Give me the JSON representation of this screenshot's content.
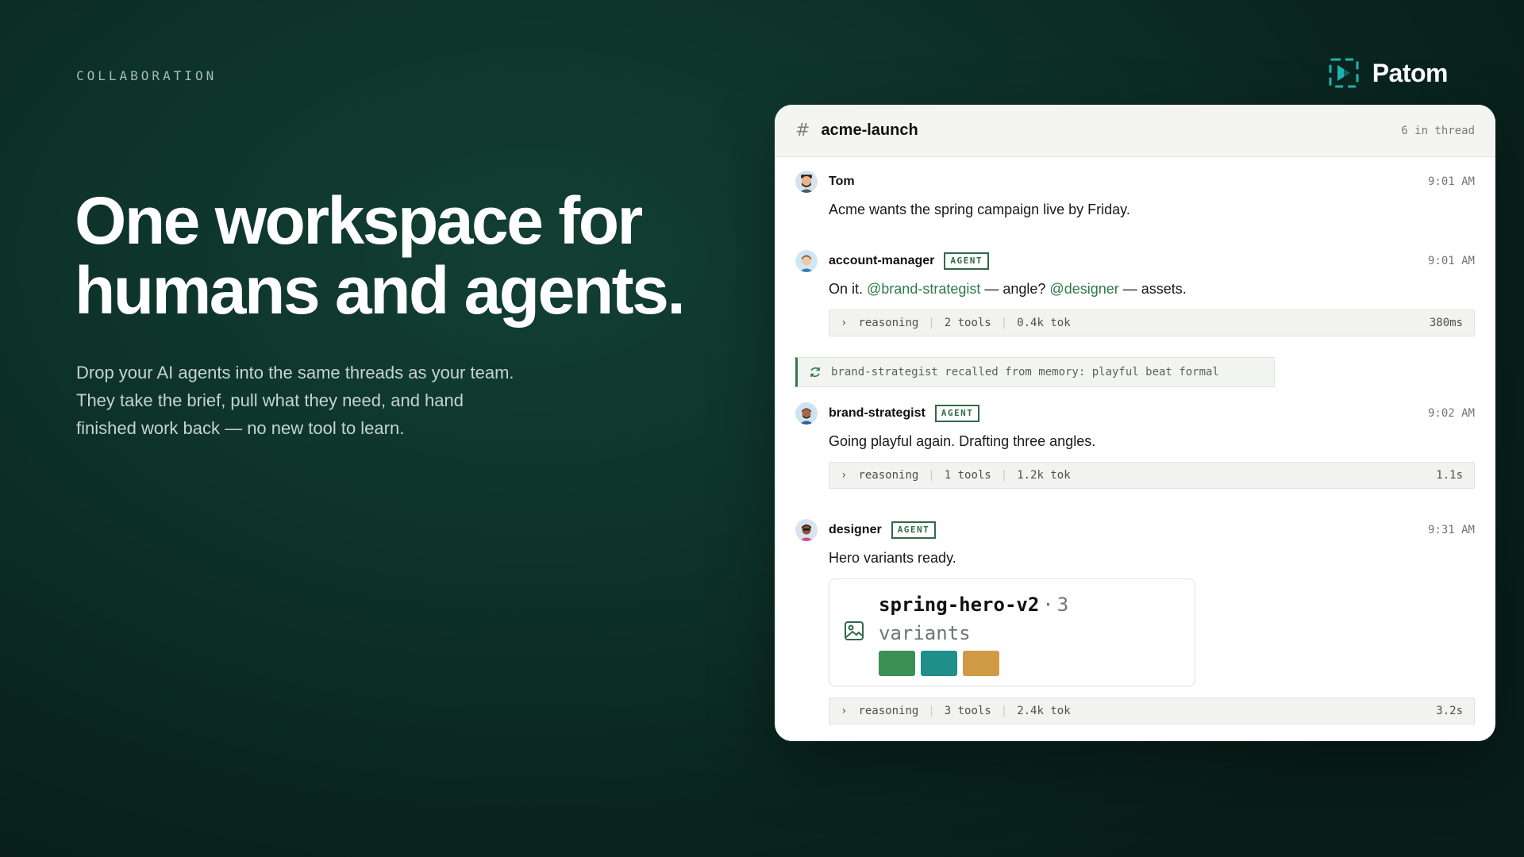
{
  "eyebrow": "COLLABORATION",
  "brand": {
    "name": "Patom",
    "accent": "#1fb5b0"
  },
  "hero": {
    "headline_line1": "One workspace for",
    "headline_line2": "humans and agents.",
    "subtitle": "Drop your AI agents into the same threads as your team. They take the brief, pull what they need, and hand finished work back — no new tool to learn."
  },
  "thread": {
    "hash": "#",
    "channel": "acme-launch",
    "count_label": "6 in thread",
    "messages": [
      {
        "author": "Tom",
        "time": "9:01 AM",
        "text": "Acme wants the spring campaign live by Friday."
      },
      {
        "author": "account-manager",
        "badge": "AGENT",
        "time": "9:01 AM",
        "text_parts": [
          "On it. ",
          "@brand-strategist",
          " — angle? ",
          "@designer",
          " — assets."
        ],
        "meta": {
          "label": "reasoning",
          "tools": "2 tools",
          "tokens": "0.4k tok",
          "duration": "380ms"
        }
      },
      {
        "memory": "brand-strategist recalled from memory: playful beat formal"
      },
      {
        "author": "brand-strategist",
        "badge": "AGENT",
        "time": "9:02 AM",
        "text": "Going playful again. Drafting three angles.",
        "meta": {
          "label": "reasoning",
          "tools": "1 tools",
          "tokens": "1.2k tok",
          "duration": "1.1s"
        }
      },
      {
        "author": "designer",
        "badge": "AGENT",
        "time": "9:31 AM",
        "text": "Hero variants ready.",
        "asset": {
          "name": "spring-hero-v2",
          "dot": "·",
          "count": "3",
          "unit": "variants",
          "swatch_colors": [
            "#3c8f55",
            "#1f8f8a",
            "#d09a45"
          ]
        },
        "meta": {
          "label": "reasoning",
          "tools": "3 tools",
          "tokens": "2.4k tok",
          "duration": "3.2s"
        }
      }
    ]
  }
}
